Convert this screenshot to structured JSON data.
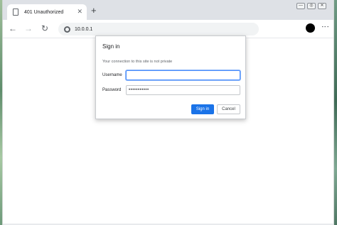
{
  "tab": {
    "title": "401 Unauthorized",
    "close_glyph": "✕",
    "new_tab_glyph": "+"
  },
  "window_controls": {
    "minimize": "—",
    "restore": "◎",
    "close": "✕"
  },
  "toolbar": {
    "back_glyph": "←",
    "forward_glyph": "→",
    "reload_glyph": "↻",
    "url": "10.0.0.1",
    "menu_glyph": "⋮"
  },
  "dialog": {
    "title": "Sign in",
    "message": "Your connection to this site is not private",
    "username_label": "Username",
    "password_label": "Password",
    "username_value": "",
    "password_value": "•••••••••••",
    "signin_label": "Sign in",
    "cancel_label": "Cancel"
  },
  "icons": {
    "tab": "page-icon",
    "site_info": "globe-icon",
    "profile": "profile-avatar"
  },
  "colors": {
    "accent": "#1a73e8",
    "tabstrip": "#dee1e6",
    "omnibox": "#f1f3f4",
    "focus_ring": "#4d90fe"
  }
}
